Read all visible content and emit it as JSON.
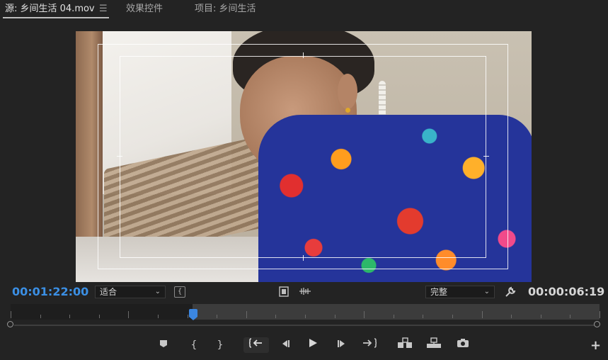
{
  "tabs": [
    {
      "label": "源: 乡间生活 04.mov",
      "active": true
    },
    {
      "label": "效果控件",
      "active": false
    },
    {
      "label": "项目: 乡间生活",
      "active": false
    }
  ],
  "tab_menu_icon": "hamburger-menu-icon",
  "viewer": {
    "clip": "乡间生活 04.mov"
  },
  "controls": {
    "timecode_current": "00:01:22:00",
    "timecode_duration": "00:00:06:19",
    "zoom_select": "适合",
    "quality_select": "完整",
    "caret": "⌄"
  },
  "timeline": {
    "playhead_position": 0.31
  },
  "transport": {
    "marker": "marker-icon",
    "mark_in": "mark-in-icon",
    "mark_out": "mark-out-icon",
    "go_to_in": "go-to-in-icon",
    "step_back": "step-back-icon",
    "play": "play-icon",
    "step_forward": "step-forward-icon",
    "go_to_out": "go-to-out-icon",
    "insert": "insert-icon",
    "overwrite": "overwrite-icon",
    "export_frame": "camera-icon",
    "add_button": "+"
  },
  "colors": {
    "accent": "#3b8fe4",
    "background": "#232323"
  }
}
